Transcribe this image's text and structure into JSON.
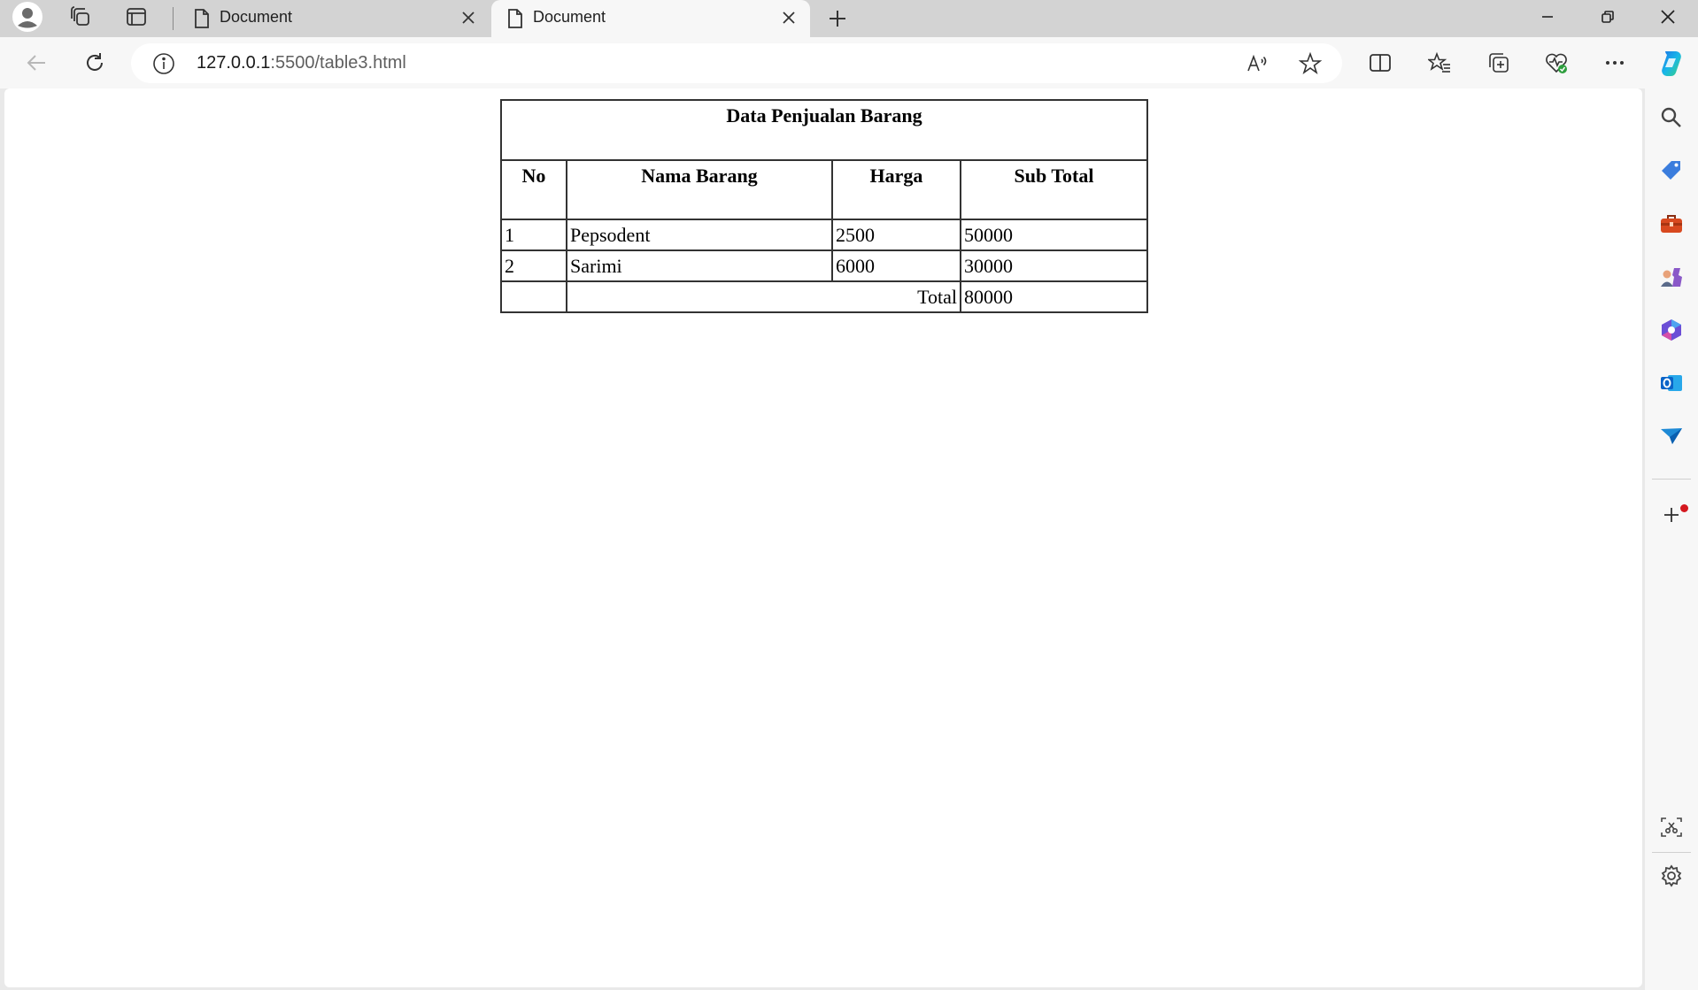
{
  "browser": {
    "tabs": [
      {
        "title": "Document",
        "active": false
      },
      {
        "title": "Document",
        "active": true
      }
    ],
    "address": {
      "host": "127.0.0.1",
      "path": ":5500/table3.html"
    },
    "accent": "#1a73e8"
  },
  "page": {
    "table": {
      "caption": "Data Penjualan Barang",
      "headers": [
        "No",
        "Nama Barang",
        "Harga",
        "Sub Total"
      ],
      "rows": [
        {
          "no": "1",
          "name": "Pepsodent",
          "price": "2500",
          "subtotal": "50000"
        },
        {
          "no": "2",
          "name": "Sarimi",
          "price": "6000",
          "subtotal": "30000"
        }
      ],
      "total_label": "Total",
      "total_value": "80000"
    }
  }
}
